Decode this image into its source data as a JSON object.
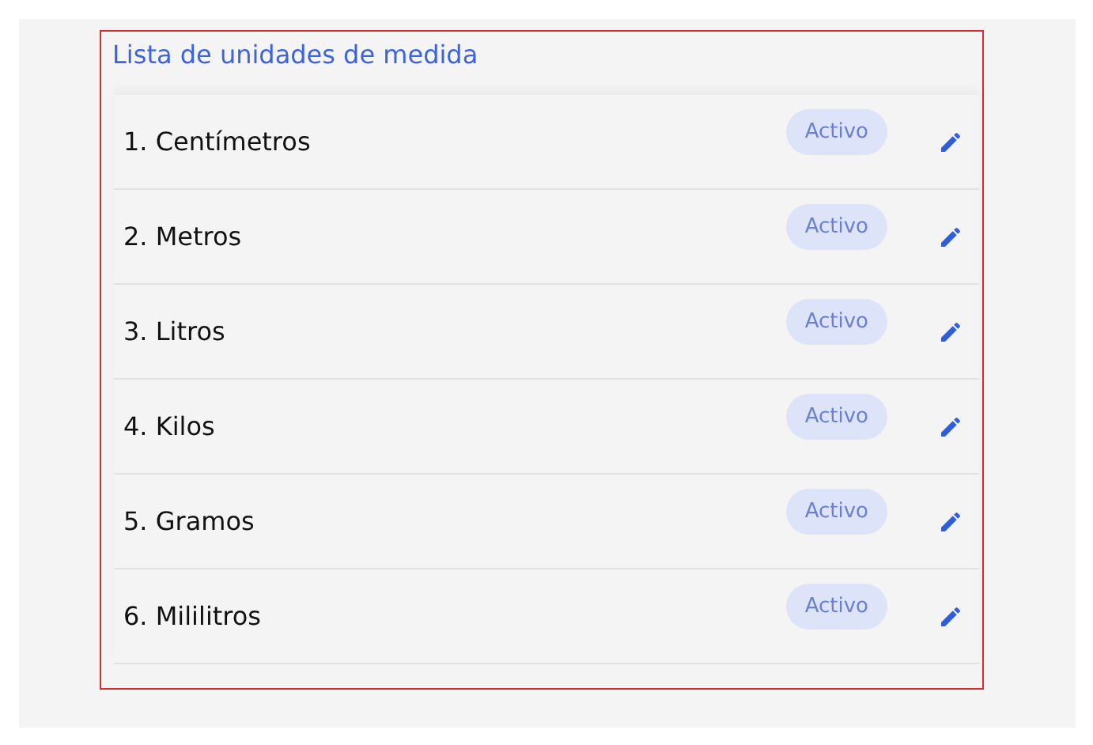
{
  "title": "Lista de unidades de medida",
  "units": [
    {
      "name": "1. Centímetros",
      "status": "Activo"
    },
    {
      "name": "2. Metros",
      "status": "Activo"
    },
    {
      "name": "3. Litros",
      "status": "Activo"
    },
    {
      "name": "4. Kilos",
      "status": "Activo"
    },
    {
      "name": "5. Gramos",
      "status": "Activo"
    },
    {
      "name": "6. Mililitros",
      "status": "Activo"
    }
  ]
}
